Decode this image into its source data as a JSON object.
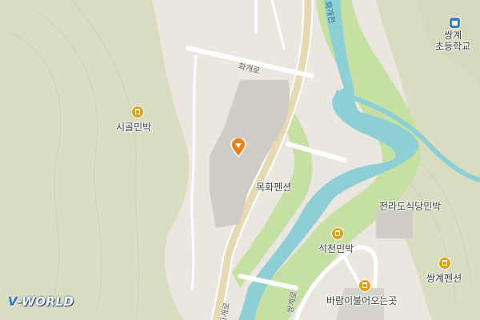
{
  "map": {
    "colors": {
      "mountain": "#dadcc0",
      "flat": "#eae7e0",
      "river": "#8ecfd6",
      "greenbelt": "#c6e0a4",
      "road": "#ffffff",
      "building": "#cfccc6",
      "poi": "#d9a11e",
      "pin": "#e8821a",
      "school": "#3a7fc4"
    },
    "places": {
      "sigol": "시골민박",
      "mokhwa": "목화펜션",
      "jeonrado": "전라도식당민박",
      "seokcheon": "석천민박",
      "ssanggye_pension": "쌍계펜션",
      "barami": "바람이불어오는곳",
      "school": "쌍계\n초등학교"
    },
    "roads": {
      "hwagye_ro_top": "화개로",
      "hwagye_ro_bottom": "화개로",
      "ssanggye_ro": "쌍계로"
    },
    "river": "화개천",
    "logo": {
      "prefix": "V",
      "text": "-WORLD"
    }
  }
}
